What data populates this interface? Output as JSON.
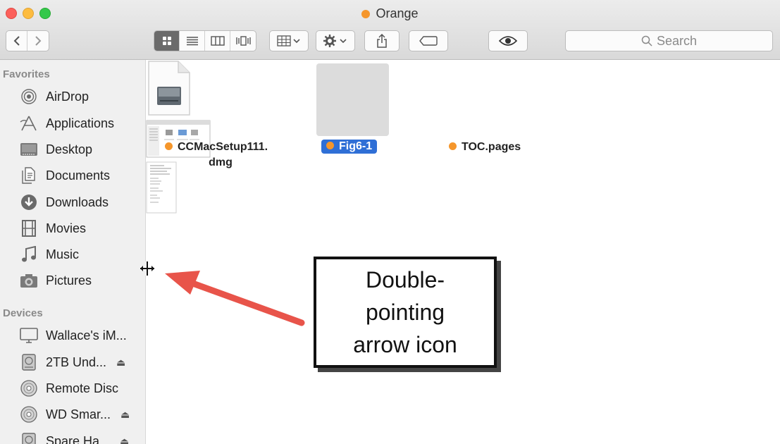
{
  "window": {
    "title": "Orange",
    "title_tag_color": "#f5962b"
  },
  "toolbar": {
    "view_modes": [
      "icon-view",
      "list-view",
      "column-view",
      "cover-flow-view"
    ],
    "search_placeholder": "Search"
  },
  "sidebar": {
    "favorites_title": "Favorites",
    "favorites": [
      {
        "label": "AirDrop",
        "icon": "airdrop-icon"
      },
      {
        "label": "Applications",
        "icon": "applications-icon"
      },
      {
        "label": "Desktop",
        "icon": "desktop-icon"
      },
      {
        "label": "Documents",
        "icon": "documents-icon"
      },
      {
        "label": "Downloads",
        "icon": "downloads-icon"
      },
      {
        "label": "Movies",
        "icon": "movies-icon"
      },
      {
        "label": "Music",
        "icon": "music-icon"
      },
      {
        "label": "Pictures",
        "icon": "pictures-icon"
      }
    ],
    "devices_title": "Devices",
    "devices": [
      {
        "label": "Wallace's iM...",
        "icon": "imac-icon",
        "eject": false
      },
      {
        "label": "2TB Und...",
        "icon": "disk-icon",
        "eject": true
      },
      {
        "label": "Remote Disc",
        "icon": "disc-icon",
        "eject": false
      },
      {
        "label": "WD Smar...",
        "icon": "disc-icon",
        "eject": true
      },
      {
        "label": "Spare Ha...",
        "icon": "disk-icon",
        "eject": true
      }
    ]
  },
  "files": [
    {
      "name_line1": "CCMacSetup111.",
      "name_line2": "dmg",
      "tag_color": "#f5962b",
      "selected": false,
      "icon": "dmg-file-icon"
    },
    {
      "name_line1": "Fig6-1",
      "name_line2": "",
      "tag_color": "#f5962b",
      "selected": true,
      "icon": "image-file-icon"
    },
    {
      "name_line1": "TOC.pages",
      "name_line2": "",
      "tag_color": "#f5962b",
      "selected": false,
      "icon": "pages-file-icon"
    }
  ],
  "callout": {
    "line1": "Double-",
    "line2": "pointing",
    "line3": "arrow icon"
  },
  "colors": {
    "arrow": "#e8544a",
    "selection": "#2f6fd6"
  }
}
